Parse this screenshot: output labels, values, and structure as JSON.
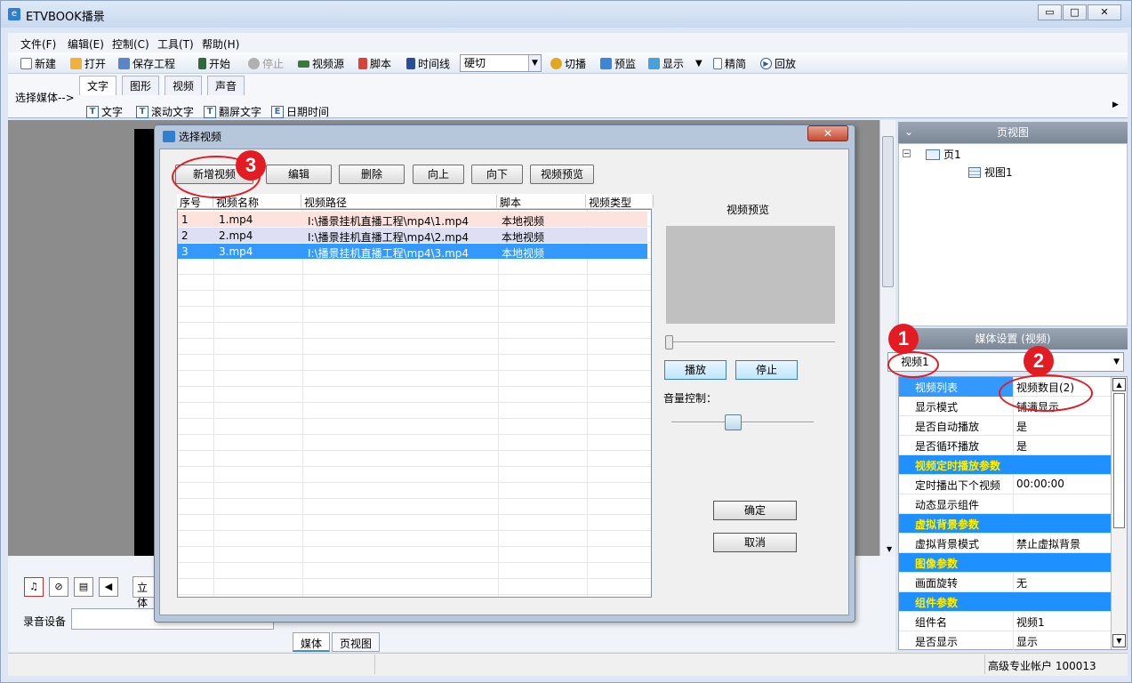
{
  "window": {
    "title": "ETVBOOK播景",
    "min": "▭",
    "max": "□",
    "close": "✕"
  },
  "menu": [
    "文件(F)",
    "编辑(E)",
    "控制(C)",
    "工具(T)",
    "帮助(H)"
  ],
  "toolbar": {
    "new": "新建",
    "open": "打开",
    "save_project": "保存工程",
    "start": "开始",
    "stop": "停止",
    "video_source": "视频源",
    "script": "脚本",
    "timeline": "时间线",
    "transition": "硬切",
    "cut": "切播",
    "monitor": "预监",
    "display": "显示",
    "simple": "精简",
    "replay": "回放"
  },
  "ribbon": {
    "select_media": "选择媒体-->",
    "tabs": [
      "文字",
      "图形",
      "视频",
      "声音"
    ],
    "items": [
      "文字",
      "滚动文字",
      "翻屏文字",
      "日期时间"
    ]
  },
  "pageview": {
    "title": "页视图",
    "page": "页1",
    "view": "视图1",
    "collapse": "⌄"
  },
  "media_settings": {
    "title": "媒体设置 (视频)",
    "selected": "视频1",
    "rows": [
      {
        "k": "视频列表",
        "v": "视频数目(2)",
        "kind": "sel"
      },
      {
        "k": "显示模式",
        "v": "铺满显示",
        "kind": "row"
      },
      {
        "k": "是否自动播放",
        "v": "是",
        "kind": "row"
      },
      {
        "k": "是否循环播放",
        "v": "是",
        "kind": "row"
      },
      {
        "k": "视频定时播放参数",
        "v": "",
        "kind": "cat"
      },
      {
        "k": "定时播出下个视频",
        "v": "00:00:00",
        "kind": "row"
      },
      {
        "k": "动态显示组件",
        "v": "",
        "kind": "row"
      },
      {
        "k": "虚拟背景参数",
        "v": "",
        "kind": "cat"
      },
      {
        "k": "虚拟背景模式",
        "v": "禁止虚拟背景",
        "kind": "row"
      },
      {
        "k": "图像参数",
        "v": "",
        "kind": "cat"
      },
      {
        "k": "画面旋转",
        "v": "无",
        "kind": "row"
      },
      {
        "k": "组件参数",
        "v": "",
        "kind": "cat"
      },
      {
        "k": "组件名",
        "v": "视频1",
        "kind": "row"
      },
      {
        "k": "是否显示",
        "v": "显示",
        "kind": "row"
      }
    ]
  },
  "bottom": {
    "stereo": "立体",
    "rec_device": "录音设备",
    "tabs": [
      "媒体",
      "页视图"
    ]
  },
  "status": {
    "account": "高级专业帐户 100013"
  },
  "dialog": {
    "title": "选择视频",
    "close": "✕",
    "buttons": [
      "新增视频",
      "编辑",
      "删除",
      "向上",
      "向下",
      "视频预览"
    ],
    "columns": [
      "序号",
      "视频名称",
      "视频路径",
      "脚本",
      "视频类型"
    ],
    "rows": [
      {
        "idx": "1",
        "name": "1.mp4",
        "path": "I:\\播景挂机直播工程\\mp4\\1.mp4",
        "script": "本地视频",
        "type": ""
      },
      {
        "idx": "2",
        "name": "2.mp4",
        "path": "I:\\播景挂机直播工程\\mp4\\2.mp4",
        "script": "本地视频",
        "type": ""
      },
      {
        "idx": "3",
        "name": "3.mp4",
        "path": "I:\\播景挂机直播工程\\mp4\\3.mp4",
        "script": "本地视频",
        "type": ""
      }
    ],
    "preview_label": "视频预览",
    "play": "播放",
    "stop": "停止",
    "volume_label": "音量控制：",
    "ok": "确定",
    "cancel": "取消"
  },
  "annotations": [
    "1",
    "2",
    "3"
  ],
  "colors": {
    "selected_row": "#3399ff",
    "row1": "#fde2dd",
    "row2": "#dde0f5",
    "category": "#1e90ff",
    "category_text": "#ffef00",
    "annotation": "#e31b23"
  }
}
